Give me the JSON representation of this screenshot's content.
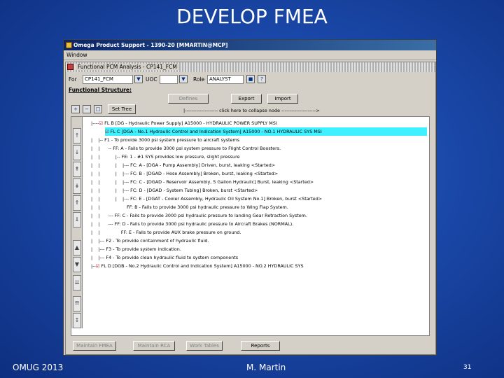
{
  "slide": {
    "title": "DEVELOP FMEA",
    "footer_left": "OMUG 2013",
    "footer_center": "M. Martin",
    "footer_right": "31"
  },
  "app": {
    "title": "Omega Product Support - 1390-20 [MMARTIN@MCP]",
    "menu_window": "Window",
    "child_title": "Functional PCM Analysis - CP141_FCM",
    "for_label": "For",
    "for_value": "CP141_FCM",
    "uoc_label": "UOC",
    "uoc_value": "",
    "role_label": "Role",
    "role_value": "ANALYST",
    "buttons": {
      "defines": "Defines",
      "export": "Export",
      "import": "Import",
      "set_tree": "Set Tree",
      "maintain_fmea": "Maintain FMEA",
      "maintain_rca": "Maintain RCA",
      "work_tables": "Work Tables",
      "reports": "Reports"
    },
    "functional_structure_label": "Functional Structure:",
    "hint": "|-------------------- click here to collapse node --------------------->",
    "tree_lines": [
      "FL B [DG - Hydraulic Power Supply] A15000 - HYDRAULIC POWER SUPPLY MSI",
      "FL C [DGA - No.1 Hydraulic Control and Indication System] A15000 - NO.1 HYDRAULIC SYS MSI",
      "F1 - To provide 3000 psi system pressure to aircraft systems",
      "FF: A - Fails to provide 3000 psi system pressure to Flight Control Boosters.",
      "FE: 1 - #1 SYS provides low pressure, slight pressure",
      "FC: A - [DGA - Pump Assembly] Driven, burst, leaking <Started>",
      "FC: B - [DGAD - Hose Assembly] Broken, burst, leaking <Started>",
      "FC: C - [DGAD - Reservoir Assembly, 5 Gallon Hydraulic] Burst, leaking <Started>",
      "FC: D - [DGAD - System Tubing] Broken, burst <Started>",
      "FC: E - [DGAT - Cooler Assembly, Hydraulic Oil System No.1] Broken, burst <Started>",
      "FF: B - Fails to provide 3000 psi hydraulic pressure to Wing Flap System.",
      "FF: C - Fails to provide 3000 psi hydraulic pressure to landing Gear Retraction System.",
      "FF: D - Fails to provide 3000 psi hydraulic pressure to Aircraft Brakes (NORMAL).",
      "FF: E - Fails to provide AUX brake pressure on ground.",
      "F2 - To provide containment of hydraulic fluid.",
      "F3 - To provide system indication.",
      "F4 - To provide clean hydraulic fluid to system components",
      "FL D [DGB - No.2 Hydraulic Control and Indication System] A15000 - NO.2 HYDRAULIC SYS"
    ]
  }
}
